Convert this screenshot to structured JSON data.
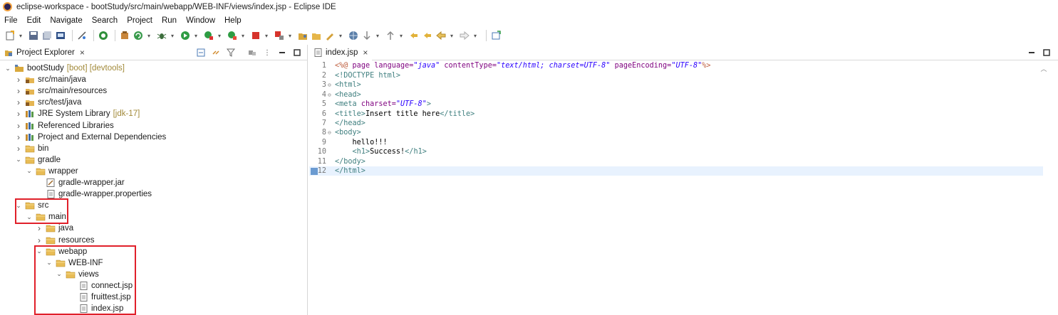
{
  "window": {
    "title": "eclipse-workspace - bootStudy/src/main/webapp/WEB-INF/views/index.jsp - Eclipse IDE"
  },
  "menu": [
    "File",
    "Edit",
    "Navigate",
    "Search",
    "Project",
    "Run",
    "Window",
    "Help"
  ],
  "explorer": {
    "tab_label": "Project Explorer",
    "tree": [
      {
        "label": "bootStudy",
        "deco": "[boot] [devtools]",
        "expanded": true,
        "depth": 0,
        "icon": "project-icon"
      },
      {
        "label": "src/main/java",
        "expanded": false,
        "depth": 1,
        "icon": "source-folder-icon"
      },
      {
        "label": "src/main/resources",
        "expanded": false,
        "depth": 1,
        "icon": "source-folder-icon"
      },
      {
        "label": "src/test/java",
        "expanded": false,
        "depth": 1,
        "icon": "source-folder-icon"
      },
      {
        "label": "JRE System Library",
        "deco": "[jdk-17]",
        "expanded": false,
        "depth": 1,
        "icon": "library-icon"
      },
      {
        "label": "Referenced Libraries",
        "expanded": false,
        "depth": 1,
        "icon": "library-icon"
      },
      {
        "label": "Project and External Dependencies",
        "expanded": false,
        "depth": 1,
        "icon": "library-icon"
      },
      {
        "label": "bin",
        "expanded": false,
        "depth": 1,
        "icon": "folder-icon"
      },
      {
        "label": "gradle",
        "expanded": true,
        "depth": 1,
        "icon": "folder-icon"
      },
      {
        "label": "wrapper",
        "expanded": true,
        "depth": 2,
        "icon": "folder-icon"
      },
      {
        "label": "gradle-wrapper.jar",
        "depth": 3,
        "icon": "jar-file-icon"
      },
      {
        "label": "gradle-wrapper.properties",
        "depth": 3,
        "icon": "file-icon"
      },
      {
        "label": "src",
        "expanded": true,
        "depth": 1,
        "icon": "folder-icon"
      },
      {
        "label": "main",
        "expanded": true,
        "depth": 2,
        "icon": "folder-icon"
      },
      {
        "label": "java",
        "expanded": false,
        "depth": 3,
        "icon": "folder-icon"
      },
      {
        "label": "resources",
        "expanded": false,
        "depth": 3,
        "icon": "folder-icon"
      },
      {
        "label": "webapp",
        "expanded": true,
        "depth": 3,
        "icon": "folder-icon"
      },
      {
        "label": "WEB-INF",
        "expanded": true,
        "depth": 4,
        "icon": "folder-icon"
      },
      {
        "label": "views",
        "expanded": true,
        "depth": 5,
        "icon": "folder-icon"
      },
      {
        "label": "connect.jsp",
        "depth": 6,
        "icon": "file-icon"
      },
      {
        "label": "fruittest.jsp",
        "depth": 6,
        "icon": "file-icon"
      },
      {
        "label": "index.jsp",
        "depth": 6,
        "icon": "file-icon"
      }
    ]
  },
  "editor": {
    "tab_label": "index.jsp",
    "current_line": 12,
    "lines": [
      {
        "n": "1",
        "fold": "",
        "tokens": [
          [
            "pct",
            "<%@ "
          ],
          [
            "a",
            "page language="
          ],
          [
            "s",
            "\"java\""
          ],
          [
            "a",
            " contentType="
          ],
          [
            "s",
            "\"text/html; charset=UTF-8\""
          ],
          [
            "a",
            " pageEncoding="
          ],
          [
            "s",
            "\"UTF-8\""
          ],
          [
            "pct",
            "%>"
          ]
        ]
      },
      {
        "n": "2",
        "fold": "",
        "tokens": [
          [
            "k",
            "<!DOCTYPE html>"
          ]
        ]
      },
      {
        "n": "3",
        "fold": "⊖",
        "tokens": [
          [
            "k",
            "<html>"
          ]
        ]
      },
      {
        "n": "4",
        "fold": "⊖",
        "tokens": [
          [
            "k",
            "<head>"
          ]
        ]
      },
      {
        "n": "5",
        "fold": "",
        "tokens": [
          [
            "k",
            "<meta "
          ],
          [
            "a",
            "charset="
          ],
          [
            "s",
            "\"UTF-8\""
          ],
          [
            "k",
            ">"
          ]
        ]
      },
      {
        "n": "6",
        "fold": "",
        "tokens": [
          [
            "k",
            "<title>"
          ],
          [
            "t",
            "Insert title here"
          ],
          [
            "k",
            "</title>"
          ]
        ]
      },
      {
        "n": "7",
        "fold": "",
        "tokens": [
          [
            "k",
            "</head>"
          ]
        ]
      },
      {
        "n": "8",
        "fold": "⊖",
        "tokens": [
          [
            "k",
            "<body>"
          ]
        ]
      },
      {
        "n": "9",
        "fold": "",
        "tokens": [
          [
            "t",
            "    hello!!!"
          ]
        ]
      },
      {
        "n": "10",
        "fold": "",
        "tokens": [
          [
            "t",
            "    "
          ],
          [
            "k",
            "<h1>"
          ],
          [
            "t",
            "Success!"
          ],
          [
            "k",
            "</h1>"
          ]
        ]
      },
      {
        "n": "11",
        "fold": "",
        "tokens": [
          [
            "k",
            "</body>"
          ]
        ]
      },
      {
        "n": "12",
        "fold": "",
        "tokens": [
          [
            "k",
            "</html>"
          ]
        ]
      }
    ]
  }
}
